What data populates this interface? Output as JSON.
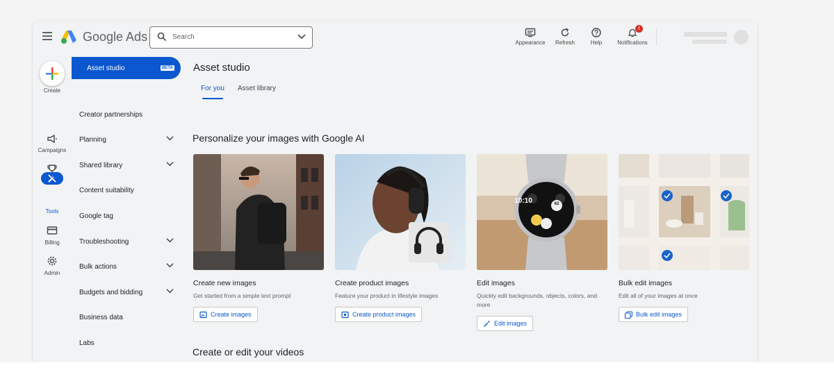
{
  "topbar": {
    "brand": "Google Ads",
    "search_placeholder": "Search",
    "actions": [
      {
        "label": "Appearance",
        "icon": "appearance-icon"
      },
      {
        "label": "Refresh",
        "icon": "refresh-icon"
      },
      {
        "label": "Help",
        "icon": "help-icon"
      },
      {
        "label": "Notifications",
        "icon": "bell-icon",
        "badge": "!"
      }
    ]
  },
  "rail": {
    "create": "Create",
    "items": [
      {
        "label": "Campaigns",
        "icon": "megaphone-icon"
      },
      {
        "label": "Goals",
        "icon": "trophy-icon"
      },
      {
        "label": "Tools",
        "icon": "tools-icon",
        "active": true
      },
      {
        "label": "Billing",
        "icon": "credit-card-icon"
      },
      {
        "label": "Admin",
        "icon": "gear-icon"
      }
    ]
  },
  "nav": {
    "active": {
      "label": "Asset studio",
      "badge": "BETA"
    },
    "items": [
      {
        "label": "Creator partnerships",
        "expandable": false
      },
      {
        "label": "Planning",
        "expandable": true
      },
      {
        "label": "Shared library",
        "expandable": true
      },
      {
        "label": "Content suitability",
        "expandable": false
      },
      {
        "label": "Google tag",
        "expandable": false
      },
      {
        "label": "Troubleshooting",
        "expandable": true
      },
      {
        "label": "Bulk actions",
        "expandable": true
      },
      {
        "label": "Budgets and bidding",
        "expandable": true
      },
      {
        "label": "Business data",
        "expandable": false
      },
      {
        "label": "Labs",
        "expandable": false
      }
    ]
  },
  "main": {
    "title": "Asset studio",
    "tabs": [
      {
        "label": "For you",
        "active": true
      },
      {
        "label": "Asset library",
        "active": false
      }
    ],
    "images_section": "Personalize your images with Google AI",
    "cards": [
      {
        "title": "Create new images",
        "desc": "Get started from a simple text prompt",
        "button": "Create images"
      },
      {
        "title": "Create product images",
        "desc": "Feature your product in lifestyle images",
        "button": "Create product images"
      },
      {
        "title": "Edit images",
        "desc": "Quickly edit backgrounds, objects, colors, and more",
        "button": "Edit images"
      },
      {
        "title": "Bulk edit images",
        "desc": "Edit all of your images at once",
        "button": "Bulk edit images"
      }
    ],
    "videos_section": "Create or edit your videos",
    "watch_time": "10:10",
    "watch_badge": "62"
  },
  "colors": {
    "accent": "#0b57d0",
    "badge": "#d93025"
  }
}
